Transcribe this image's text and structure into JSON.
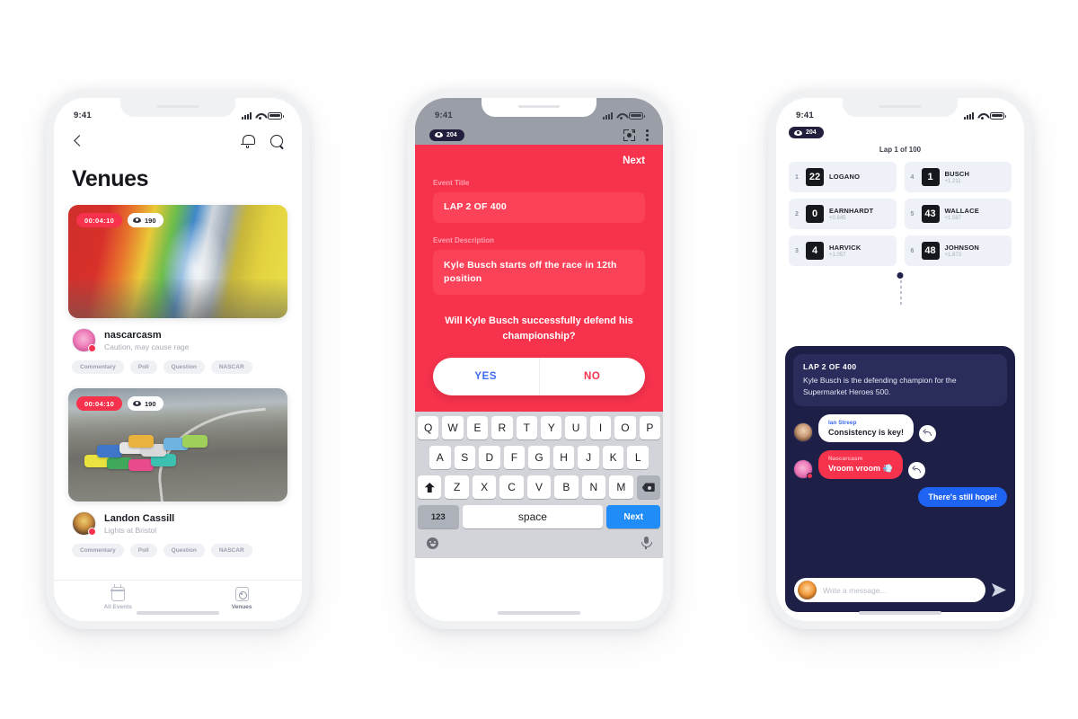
{
  "meta": {
    "background": "#ffffff",
    "accent_red": "#f6324c",
    "accent_blue": "#1f63f2",
    "chat_navy": "#1d1f47"
  },
  "phone1": {
    "status": {
      "time": "9:41"
    },
    "nav": {
      "back_icon": "chevron-left-icon",
      "bell_icon": "bell-icon",
      "search_icon": "search-icon"
    },
    "title": "Venues",
    "cards": [
      {
        "duration": "00:04:10",
        "views": "190",
        "name": "nascarcasm",
        "subtitle": "Caution, may cause rage",
        "tags": [
          "Commentary",
          "Poll",
          "Question",
          "NASCAR"
        ]
      },
      {
        "duration": "00:04:10",
        "views": "190",
        "name": "Landon Cassill",
        "subtitle": "Lights at Bristol",
        "tags": [
          "Commentary",
          "Poll",
          "Question",
          "NASCAR"
        ]
      }
    ],
    "tabs": [
      {
        "label": "All Events",
        "icon": "calendar-icon",
        "active": false
      },
      {
        "label": "Venues",
        "icon": "venue-icon",
        "active": true
      }
    ]
  },
  "phone2": {
    "status": {
      "time": "9:41"
    },
    "topbar": {
      "views": "204",
      "scan_icon": "scan-icon",
      "more_icon": "more-vertical-icon"
    },
    "next_label": "Next",
    "fields": [
      {
        "label": "Event Title",
        "value": "LAP 2 OF 400"
      },
      {
        "label": "Event Description",
        "value": "Kyle Busch starts off the race in 12th position"
      }
    ],
    "poll": {
      "question": "Will Kyle Busch successfully defend his championship?",
      "yes": "YES",
      "no": "NO"
    },
    "keyboard": {
      "row1": [
        "Q",
        "W",
        "E",
        "R",
        "T",
        "Y",
        "U",
        "I",
        "O",
        "P"
      ],
      "row2": [
        "A",
        "S",
        "D",
        "F",
        "G",
        "H",
        "J",
        "K",
        "L"
      ],
      "row3": [
        "Z",
        "X",
        "C",
        "V",
        "B",
        "N",
        "M"
      ],
      "shift_icon": "shift-icon",
      "backspace_icon": "backspace-icon",
      "numeric_label": "123",
      "space_label": "space",
      "return_label": "Next",
      "emoji_icon": "emoji-icon",
      "mic_icon": "microphone-icon"
    }
  },
  "phone3": {
    "status": {
      "time": "9:41"
    },
    "views": "204",
    "lap_label": "Lap 1 of 100",
    "leaderboard": [
      {
        "pos": "1",
        "num": "22",
        "name": "LOGANO",
        "delta": ""
      },
      {
        "pos": "4",
        "num": "1",
        "name": "BUSCH",
        "delta": "+1.211"
      },
      {
        "pos": "2",
        "num": "0",
        "name": "EARNHARDT",
        "delta": "+0.845"
      },
      {
        "pos": "5",
        "num": "43",
        "name": "WALLACE",
        "delta": "+1.587"
      },
      {
        "pos": "3",
        "num": "4",
        "name": "HARVICK",
        "delta": "+1.057"
      },
      {
        "pos": "6",
        "num": "48",
        "name": "JOHNSON",
        "delta": "+1.873"
      }
    ],
    "banner": {
      "title": "LAP 2 OF 400",
      "body": "Kyle Busch is the defending champion for the Supermarket Heroes 500."
    },
    "messages": [
      {
        "side": "left",
        "style": "white",
        "name": "Ian Streep",
        "text": "Consistency is key!",
        "reply_icon": "reply-icon"
      },
      {
        "side": "left",
        "style": "red",
        "name": "Nascarcasm",
        "text": "Vroom vroom 💨",
        "reply_icon": "reply-icon"
      },
      {
        "side": "right",
        "style": "blue",
        "name": "",
        "text": "There's still hope!",
        "reply_icon": ""
      }
    ],
    "composer": {
      "placeholder": "Write a message...",
      "send_icon": "send-icon",
      "avatar": "user-avatar"
    }
  }
}
